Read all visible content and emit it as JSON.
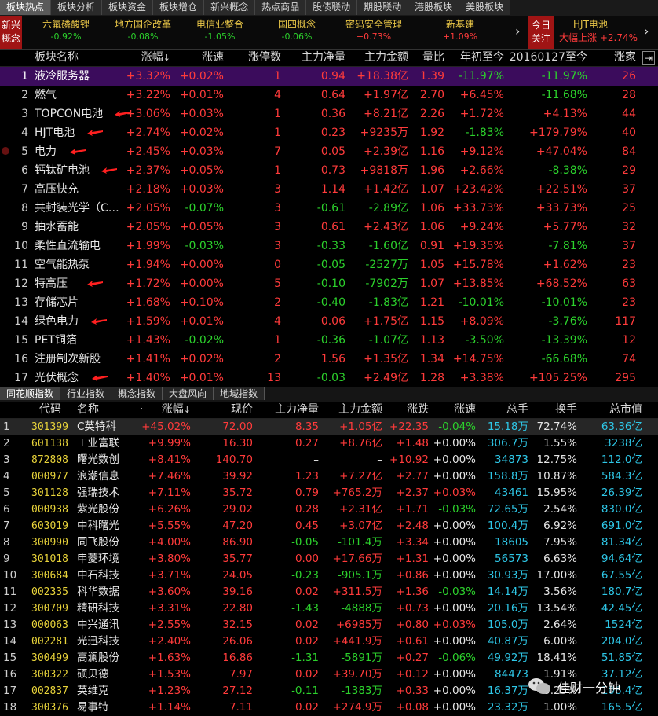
{
  "top_tabs": [
    "板块热点",
    "板块分析",
    "板块资金",
    "板块增仓",
    "新兴概念",
    "热点商品",
    "股债联动",
    "期股联动",
    "港股板块",
    "美股板块"
  ],
  "strip": {
    "label": "新兴概念",
    "items": [
      {
        "name": "六氟磷酸锂",
        "change": "-0.92%"
      },
      {
        "name": "地方国企改革",
        "change": "-0.08%"
      },
      {
        "name": "电信业整合",
        "change": "-1.05%"
      },
      {
        "name": "国四概念",
        "change": "-0.06%"
      },
      {
        "name": "密码安全管理",
        "change": "+0.73%"
      },
      {
        "name": "新基建",
        "change": "+1.09%"
      }
    ],
    "arrow": "›",
    "today_label": "今日关注",
    "today_name": "HJT电池",
    "today_status": "大幅上涨",
    "today_change": "+2.74%",
    "right_arrow": "›"
  },
  "sector_headers": {
    "name": "板块名称",
    "pct": "涨幅",
    "pct_arrow": "↓",
    "speed": "涨速",
    "limit": "涨停数",
    "net": "主力净量",
    "amount": "主力金额",
    "vol_ratio": "量比",
    "ytd": "年初至今",
    "since2016": "20160127至今",
    "up": "涨家"
  },
  "sectors": [
    {
      "n": "1",
      "name": "液冷服务器",
      "pct": "+3.32%",
      "spd": "+0.02%",
      "lim": "1",
      "net": "0.94",
      "amt": "+18.38亿",
      "vr": "1.39",
      "ytd": "-11.97%",
      "s16": "-11.97%",
      "up": "26"
    },
    {
      "n": "2",
      "name": "燃气",
      "pct": "+3.22%",
      "spd": "+0.01%",
      "lim": "4",
      "net": "0.64",
      "amt": "+1.97亿",
      "vr": "2.70",
      "ytd": "+6.45%",
      "s16": "-11.68%",
      "up": "28"
    },
    {
      "n": "3",
      "name": "TOPCON电池",
      "pct": "+3.06%",
      "spd": "+0.03%",
      "lim": "1",
      "net": "0.36",
      "amt": "+8.21亿",
      "vr": "2.26",
      "ytd": "+1.72%",
      "s16": "+4.13%",
      "up": "44"
    },
    {
      "n": "4",
      "name": "HJT电池",
      "pct": "+2.74%",
      "spd": "+0.02%",
      "lim": "1",
      "net": "0.23",
      "amt": "+9235万",
      "vr": "1.92",
      "ytd": "-1.83%",
      "s16": "+179.79%",
      "up": "40"
    },
    {
      "n": "5",
      "name": "电力",
      "pct": "+2.45%",
      "spd": "+0.03%",
      "lim": "7",
      "net": "0.05",
      "amt": "+2.39亿",
      "vr": "1.16",
      "ytd": "+9.12%",
      "s16": "+47.04%",
      "up": "84"
    },
    {
      "n": "6",
      "name": "钙钛矿电池",
      "pct": "+2.37%",
      "spd": "+0.05%",
      "lim": "1",
      "net": "0.73",
      "amt": "+9818万",
      "vr": "1.96",
      "ytd": "+2.66%",
      "s16": "-8.38%",
      "up": "29"
    },
    {
      "n": "7",
      "name": "高压快充",
      "pct": "+2.18%",
      "spd": "+0.03%",
      "lim": "3",
      "net": "1.14",
      "amt": "+1.42亿",
      "vr": "1.07",
      "ytd": "+23.42%",
      "s16": "+22.51%",
      "up": "37"
    },
    {
      "n": "8",
      "name": "共封装光学（C…",
      "pct": "+2.05%",
      "spd": "-0.07%",
      "lim": "3",
      "net": "-0.61",
      "amt": "-2.89亿",
      "vr": "1.06",
      "ytd": "+33.73%",
      "s16": "+33.73%",
      "up": "25"
    },
    {
      "n": "9",
      "name": "抽水蓄能",
      "pct": "+2.05%",
      "spd": "+0.05%",
      "lim": "3",
      "net": "0.61",
      "amt": "+2.43亿",
      "vr": "1.06",
      "ytd": "+9.24%",
      "s16": "+5.77%",
      "up": "32"
    },
    {
      "n": "10",
      "name": "柔性直流输电",
      "pct": "+1.99%",
      "spd": "-0.03%",
      "lim": "3",
      "net": "-0.33",
      "amt": "-1.60亿",
      "vr": "0.91",
      "ytd": "+19.35%",
      "s16": "-7.81%",
      "up": "37"
    },
    {
      "n": "11",
      "name": "空气能热泵",
      "pct": "+1.94%",
      "spd": "+0.00%",
      "lim": "0",
      "net": "-0.05",
      "amt": "-2527万",
      "vr": "1.05",
      "ytd": "+15.78%",
      "s16": "+1.62%",
      "up": "23"
    },
    {
      "n": "12",
      "name": "特高压",
      "pct": "+1.72%",
      "spd": "+0.00%",
      "lim": "5",
      "net": "-0.10",
      "amt": "-7902万",
      "vr": "1.07",
      "ytd": "+13.85%",
      "s16": "+68.52%",
      "up": "63"
    },
    {
      "n": "13",
      "name": "存储芯片",
      "pct": "+1.68%",
      "spd": "+0.10%",
      "lim": "2",
      "net": "-0.40",
      "amt": "-1.83亿",
      "vr": "1.21",
      "ytd": "-10.01%",
      "s16": "-10.01%",
      "up": "23"
    },
    {
      "n": "14",
      "name": "绿色电力",
      "pct": "+1.59%",
      "spd": "+0.01%",
      "lim": "4",
      "net": "0.06",
      "amt": "+1.75亿",
      "vr": "1.15",
      "ytd": "+8.09%",
      "s16": "-3.76%",
      "up": "117"
    },
    {
      "n": "15",
      "name": "PET铜箔",
      "pct": "+1.43%",
      "spd": "-0.02%",
      "lim": "1",
      "net": "-0.36",
      "amt": "-1.07亿",
      "vr": "1.13",
      "ytd": "-3.50%",
      "s16": "-13.39%",
      "up": "12"
    },
    {
      "n": "16",
      "name": "注册制次新股",
      "pct": "+1.41%",
      "spd": "+0.02%",
      "lim": "2",
      "net": "1.56",
      "amt": "+1.35亿",
      "vr": "1.34",
      "ytd": "+14.75%",
      "s16": "-66.68%",
      "up": "74"
    },
    {
      "n": "17",
      "name": "光伏概念",
      "pct": "+1.40%",
      "spd": "+0.01%",
      "lim": "13",
      "net": "-0.03",
      "amt": "+2.49亿",
      "vr": "1.28",
      "ytd": "+3.38%",
      "s16": "+105.25%",
      "up": "295"
    }
  ],
  "bottom_tabs": [
    "同花顺指数",
    "行业指数",
    "概念指数",
    "大盘风向",
    "地域指数"
  ],
  "stock_headers": {
    "code": "代码",
    "name": "名称",
    "dot": "·",
    "pct": "涨幅",
    "pct_arrow": "↓",
    "price": "现价",
    "net": "主力净量",
    "amt": "主力金额",
    "chg": "涨跌",
    "spd": "涨速",
    "hand": "总手",
    "turn": "换手",
    "cap": "总市值"
  },
  "stocks": [
    {
      "n": "1",
      "code": "301399",
      "name": "C英特科",
      "pct": "+45.02%",
      "px": "72.00",
      "net": "8.35",
      "amt": "+1.05亿",
      "chg": "+22.35",
      "spd": "-0.04%",
      "hand": "15.18万",
      "turn": "72.74%",
      "cap": "63.36亿"
    },
    {
      "n": "2",
      "code": "601138",
      "name": "工业富联",
      "pct": "+9.99%",
      "px": "16.30",
      "net": "0.27",
      "amt": "+8.76亿",
      "chg": "+1.48",
      "spd": "+0.00%",
      "hand": "306.7万",
      "turn": "1.55%",
      "cap": "3238亿"
    },
    {
      "n": "3",
      "code": "872808",
      "name": "曙光数创",
      "pct": "+8.41%",
      "px": "140.70",
      "net": "–",
      "amt": "–",
      "chg": "+10.92",
      "spd": "+0.00%",
      "hand": "34873",
      "turn": "12.75%",
      "cap": "112.0亿"
    },
    {
      "n": "4",
      "code": "000977",
      "name": "浪潮信息",
      "pct": "+7.46%",
      "px": "39.92",
      "net": "1.23",
      "amt": "+7.27亿",
      "chg": "+2.77",
      "spd": "+0.00%",
      "hand": "158.8万",
      "turn": "10.87%",
      "cap": "584.3亿"
    },
    {
      "n": "5",
      "code": "301128",
      "name": "强瑞技术",
      "pct": "+7.11%",
      "px": "35.72",
      "net": "0.79",
      "amt": "+765.2万",
      "chg": "+2.37",
      "spd": "+0.03%",
      "hand": "43461",
      "turn": "15.95%",
      "cap": "26.39亿"
    },
    {
      "n": "6",
      "code": "000938",
      "name": "紫光股份",
      "pct": "+6.26%",
      "px": "29.02",
      "net": "0.28",
      "amt": "+2.31亿",
      "chg": "+1.71",
      "spd": "-0.03%",
      "hand": "72.65万",
      "turn": "2.54%",
      "cap": "830.0亿"
    },
    {
      "n": "7",
      "code": "603019",
      "name": "中科曙光",
      "pct": "+5.55%",
      "px": "47.20",
      "net": "0.45",
      "amt": "+3.07亿",
      "chg": "+2.48",
      "spd": "+0.00%",
      "hand": "100.4万",
      "turn": "6.92%",
      "cap": "691.0亿"
    },
    {
      "n": "8",
      "code": "300990",
      "name": "同飞股份",
      "pct": "+4.00%",
      "px": "86.90",
      "net": "-0.05",
      "amt": "-101.4万",
      "chg": "+3.34",
      "spd": "+0.00%",
      "hand": "18605",
      "turn": "7.95%",
      "cap": "81.34亿"
    },
    {
      "n": "9",
      "code": "301018",
      "name": "申菱环境",
      "pct": "+3.80%",
      "px": "35.77",
      "net": "0.00",
      "amt": "+17.66万",
      "chg": "+1.31",
      "spd": "+0.00%",
      "hand": "56573",
      "turn": "6.63%",
      "cap": "94.64亿"
    },
    {
      "n": "10",
      "code": "300684",
      "name": "中石科技",
      "pct": "+3.71%",
      "px": "24.05",
      "net": "-0.23",
      "amt": "-905.1万",
      "chg": "+0.86",
      "spd": "+0.00%",
      "hand": "30.93万",
      "turn": "17.00%",
      "cap": "67.55亿"
    },
    {
      "n": "11",
      "code": "002335",
      "name": "科华数据",
      "pct": "+3.60%",
      "px": "39.16",
      "net": "0.02",
      "amt": "+311.5万",
      "chg": "+1.36",
      "spd": "-0.03%",
      "hand": "14.14万",
      "turn": "3.56%",
      "cap": "180.7亿"
    },
    {
      "n": "12",
      "code": "300709",
      "name": "精研科技",
      "pct": "+3.31%",
      "px": "22.80",
      "net": "-1.43",
      "amt": "-4888万",
      "chg": "+0.73",
      "spd": "+0.00%",
      "hand": "20.16万",
      "turn": "13.54%",
      "cap": "42.45亿"
    },
    {
      "n": "13",
      "code": "000063",
      "name": "中兴通讯",
      "pct": "+2.55%",
      "px": "32.15",
      "net": "0.02",
      "amt": "+6985万",
      "chg": "+0.80",
      "spd": "+0.03%",
      "hand": "105.0万",
      "turn": "2.64%",
      "cap": "1524亿"
    },
    {
      "n": "14",
      "code": "002281",
      "name": "光迅科技",
      "pct": "+2.40%",
      "px": "26.06",
      "net": "0.02",
      "amt": "+441.9万",
      "chg": "+0.61",
      "spd": "+0.00%",
      "hand": "40.87万",
      "turn": "6.00%",
      "cap": "204.0亿"
    },
    {
      "n": "15",
      "code": "300499",
      "name": "高澜股份",
      "pct": "+1.63%",
      "px": "16.86",
      "net": "-1.31",
      "amt": "-5891万",
      "chg": "+0.27",
      "spd": "-0.06%",
      "hand": "49.92万",
      "turn": "18.41%",
      "cap": "51.85亿"
    },
    {
      "n": "16",
      "code": "300322",
      "name": "硕贝德",
      "pct": "+1.53%",
      "px": "7.97",
      "net": "0.02",
      "amt": "+39.70万",
      "chg": "+0.12",
      "spd": "+0.00%",
      "hand": "84473",
      "turn": "1.91%",
      "cap": "37.12亿"
    },
    {
      "n": "17",
      "code": "002837",
      "name": "英维克",
      "pct": "+1.23%",
      "px": "27.12",
      "net": "-0.11",
      "amt": "-1383万",
      "chg": "+0.33",
      "spd": "+0.00%",
      "hand": "16.37万",
      "turn": "5.25%",
      "cap": "106.4亿"
    },
    {
      "n": "18",
      "code": "300376",
      "name": "易事特",
      "pct": "+1.14%",
      "px": "7.11",
      "net": "0.02",
      "amt": "+274.9万",
      "chg": "+0.08",
      "spd": "+0.00%",
      "hand": "23.32万",
      "turn": "1.00%",
      "cap": "165.5亿"
    }
  ],
  "watermark": "佳财一分钟",
  "colors": {
    "up": "#ff3b3b",
    "down": "#2cd12c",
    "selected_row": "#3b0c5c",
    "accent": "#a01414"
  }
}
